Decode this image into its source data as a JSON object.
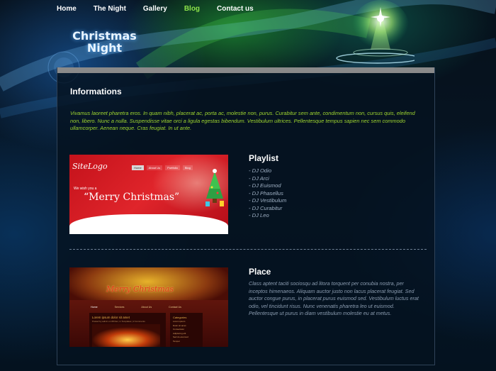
{
  "nav": {
    "items": [
      "Home",
      "The Night",
      "Gallery",
      "Blog",
      "Contact us"
    ],
    "active": "Blog"
  },
  "logo": {
    "line1": "Christmas",
    "line2": "Night"
  },
  "content": {
    "heading": "Informations",
    "intro": "Vivamus laoreet pharetra eros. In quam nibh, placerat ac, porta ac, molestie non, purus. Curabitur sem ante, condimentum non, cursus quis, eleifend non, libero. Nunc a nulla. Suspendisse vitae orci a ligula egestas bibendum. Vestibulum ultrices. Pellentesque tempus sapien nec sem commodo ullamcorper. Aenean neque. Cras feugiat. In ut ante."
  },
  "playlist": {
    "title": "Playlist",
    "items": [
      "- DJ Odio",
      "- DJ Arci",
      "- DJ Euismod",
      "- DJ Phasellus",
      "- DJ Vestibulum",
      "- DJ Curabitur",
      "- DJ Leo"
    ]
  },
  "place": {
    "title": "Place",
    "text": "Class aptent taciti sociosqu ad litora torquent per conubia nostra, per inceptos himenaeos. Aliquam auctor justo non lacus placerat feugiat. Sed auctor congue purus, in placerat purus euismod sed. Vestibulum luctus erat odio, vel tincidunt risus. Nunc venenatis pharetra leo ut euismod. Pellentesque ut purus in diam vestibulum molestie eu at metus."
  },
  "thumb1": {
    "sitelogo": "SiteLogo",
    "nav": [
      "Home",
      "About Us",
      "Portfolio",
      "Blog"
    ],
    "wish": "We wish you a",
    "merry": "“Merry Christmas”"
  },
  "thumb2": {
    "banner": "Merry Christmas",
    "nav": [
      "Home",
      "Services",
      "About Us",
      "Contact Us"
    ],
    "lorem": "Lorem ipsum dolor sit amet",
    "lorem_sub": "Posted by admin on 08 Dec, in Templates | 2 Comments",
    "categories_title": "Categories",
    "categories": [
      "Lorem ipsum",
      "Dolor sit amet",
      "Consectetur",
      "Adipiscing elit",
      "Sed do eiusmod",
      "Tempor"
    ]
  },
  "colors": {
    "accent_green": "#8ee34a",
    "intro_text": "#9fd630",
    "body_text": "#8b9cb0",
    "panel_bar": "#8a8a8a"
  },
  "icons": [
    "christmas-tree-ornament-icon",
    "christmas-tree-icon"
  ]
}
